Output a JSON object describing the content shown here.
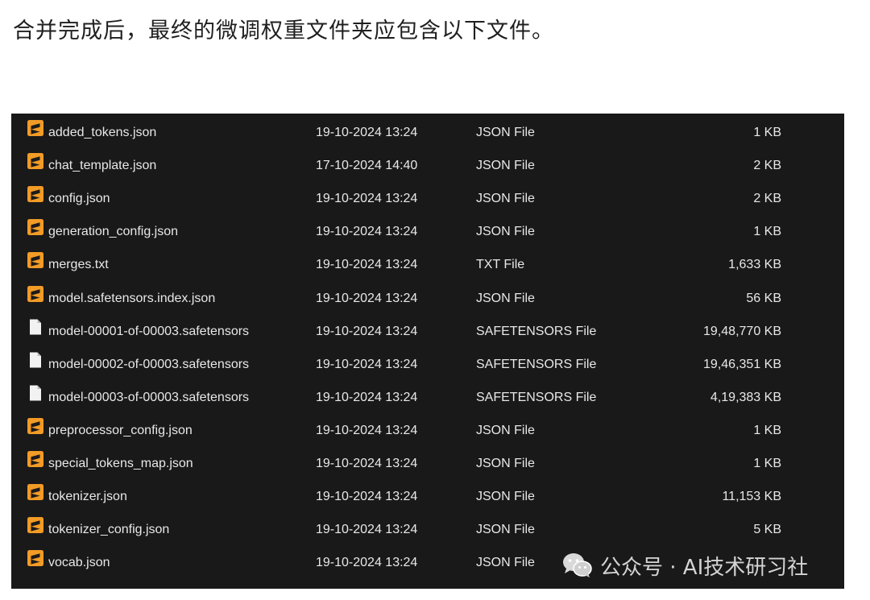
{
  "heading": "合并完成后，最终的微调权重文件夹应包含以下文件。",
  "colors": {
    "panel_background": "#191919",
    "text": "#e8e8e8",
    "sublime_icon_orange": "#f29b26",
    "generic_file_icon": "#f2f2f2"
  },
  "files": [
    {
      "name": "added_tokens.json",
      "date": "19-10-2024 13:24",
      "type": "JSON File",
      "size": "1 KB",
      "icon": "sublime-text-icon"
    },
    {
      "name": "chat_template.json",
      "date": "17-10-2024 14:40",
      "type": "JSON File",
      "size": "2 KB",
      "icon": "sublime-text-icon"
    },
    {
      "name": "config.json",
      "date": "19-10-2024 13:24",
      "type": "JSON File",
      "size": "2 KB",
      "icon": "sublime-text-icon"
    },
    {
      "name": "generation_config.json",
      "date": "19-10-2024 13:24",
      "type": "JSON File",
      "size": "1 KB",
      "icon": "sublime-text-icon"
    },
    {
      "name": "merges.txt",
      "date": "19-10-2024 13:24",
      "type": "TXT File",
      "size": "1,633 KB",
      "icon": "sublime-text-icon"
    },
    {
      "name": "model.safetensors.index.json",
      "date": "19-10-2024 13:24",
      "type": "JSON File",
      "size": "56 KB",
      "icon": "sublime-text-icon"
    },
    {
      "name": "model-00001-of-00003.safetensors",
      "date": "19-10-2024 13:24",
      "type": "SAFETENSORS File",
      "size": "19,48,770 KB",
      "icon": "file-icon"
    },
    {
      "name": "model-00002-of-00003.safetensors",
      "date": "19-10-2024 13:24",
      "type": "SAFETENSORS File",
      "size": "19,46,351 KB",
      "icon": "file-icon"
    },
    {
      "name": "model-00003-of-00003.safetensors",
      "date": "19-10-2024 13:24",
      "type": "SAFETENSORS File",
      "size": "4,19,383 KB",
      "icon": "file-icon"
    },
    {
      "name": "preprocessor_config.json",
      "date": "19-10-2024 13:24",
      "type": "JSON File",
      "size": "1 KB",
      "icon": "sublime-text-icon"
    },
    {
      "name": "special_tokens_map.json",
      "date": "19-10-2024 13:24",
      "type": "JSON File",
      "size": "1 KB",
      "icon": "sublime-text-icon"
    },
    {
      "name": "tokenizer.json",
      "date": "19-10-2024 13:24",
      "type": "JSON File",
      "size": "11,153 KB",
      "icon": "sublime-text-icon"
    },
    {
      "name": "tokenizer_config.json",
      "date": "19-10-2024 13:24",
      "type": "JSON File",
      "size": "5 KB",
      "icon": "sublime-text-icon"
    },
    {
      "name": "vocab.json",
      "date": "19-10-2024 13:24",
      "type": "JSON File",
      "size": "",
      "icon": "sublime-text-icon"
    }
  ],
  "watermark": {
    "text": "公众号 · AI技术研习社",
    "icon": "wechat-icon"
  }
}
